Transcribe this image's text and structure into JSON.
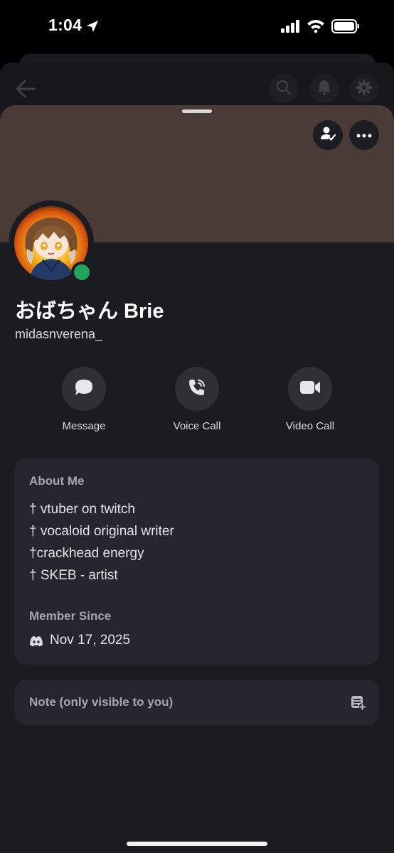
{
  "status_bar": {
    "time": "1:04"
  },
  "profile": {
    "display_name": "おばちゃん Brie",
    "username": "midasnverena_",
    "banner_color": "#4b3b36",
    "status": "online"
  },
  "actions": [
    {
      "label": "Message",
      "icon": "message-icon"
    },
    {
      "label": "Voice Call",
      "icon": "phone-icon"
    },
    {
      "label": "Video Call",
      "icon": "video-camera-icon"
    }
  ],
  "about": {
    "title": "About Me",
    "lines": [
      "† vtuber on twitch",
      "† vocaloid original writer",
      "†crackhead energy",
      "† SKEB - artist"
    ]
  },
  "member_since": {
    "title": "Member Since",
    "date": "Nov 17, 2025"
  },
  "note": {
    "label": "Note (only visible to you)"
  }
}
